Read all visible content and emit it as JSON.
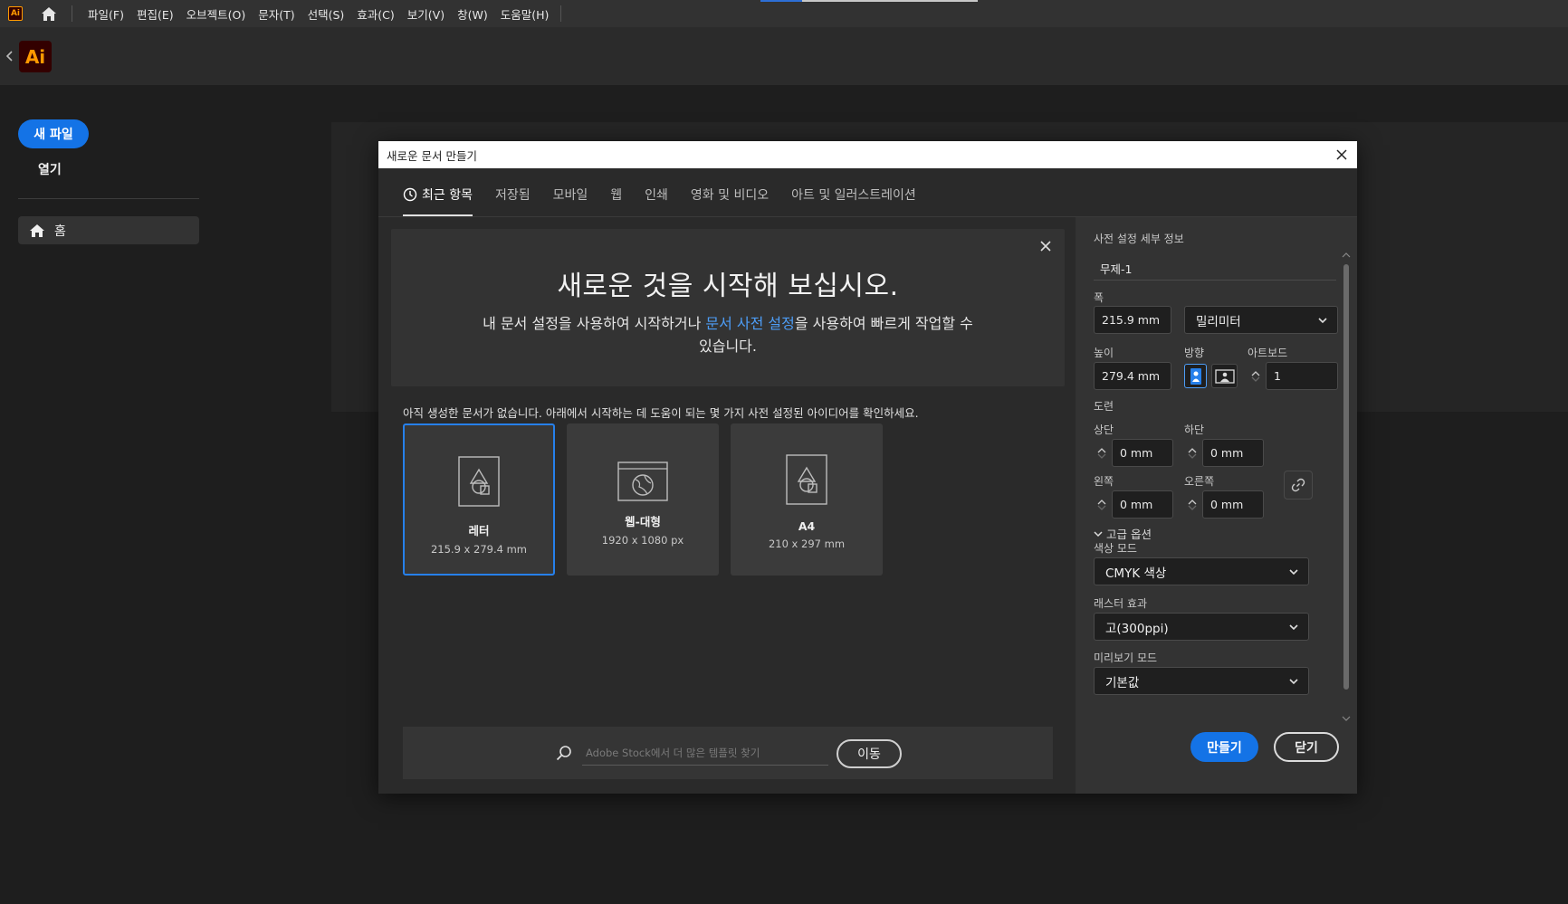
{
  "menubar": {
    "app_mini_logo": "Ai",
    "items": [
      "파일(F)",
      "편집(E)",
      "오브젝트(O)",
      "문자(T)",
      "선택(S)",
      "효과(C)",
      "보기(V)",
      "창(W)",
      "도움말(H)"
    ]
  },
  "appbar": {
    "logo": "Ai"
  },
  "sidebar": {
    "new_file": "새 파일",
    "open": "열기",
    "home": "홈"
  },
  "dialog": {
    "title": "새로운 문서 만들기",
    "tabs": [
      "최근 항목",
      "저장됨",
      "모바일",
      "웹",
      "인쇄",
      "영화 및 비디오",
      "아트 및 일러스트레이션"
    ],
    "hero": {
      "title": "새로운 것을 시작해 보십시오.",
      "desc_before": "내 문서 설정을 사용하여 시작하거나 ",
      "desc_link": "문서 사전 설정",
      "desc_after": "을 사용하여 빠르게 작업할 수 있습니다."
    },
    "info": "아직 생성한 문서가 없습니다. 아래에서 시작하는 데 도움이 되는 몇 가지 사전 설정된 아이디어를 확인하세요.",
    "cards": [
      {
        "name": "레터",
        "size": "215.9 x 279.4 mm"
      },
      {
        "name": "웹-대형",
        "size": "1920 x 1080 px"
      },
      {
        "name": "A4",
        "size": "210 x 297 mm"
      }
    ],
    "stock": {
      "placeholder": "Adobe Stock에서 더 많은 템플릿 찾기",
      "go": "이동"
    },
    "preset": {
      "header": "사전 설정 세부 정보",
      "name": "무제-1",
      "width_label": "폭",
      "width": "215.9 mm",
      "unit": "밀리미터",
      "height_label": "높이",
      "height": "279.4 mm",
      "orientation_label": "방향",
      "artboard_label": "아트보드",
      "artboard": "1",
      "bleed_label": "도련",
      "top_label": "상단",
      "top": "0 mm",
      "bottom_label": "하단",
      "bottom": "0 mm",
      "left_label": "왼쪽",
      "left": "0 mm",
      "right_label": "오른쪽",
      "right": "0 mm",
      "advanced": "고급 옵션",
      "color_mode_label": "색상 모드",
      "color_mode": "CMYK 색상",
      "raster_label": "래스터 효과",
      "raster": "고(300ppi)",
      "preview_label": "미리보기 모드",
      "preview": "기본값",
      "create": "만들기",
      "close": "닫기"
    }
  },
  "colors": {
    "accent": "#1473e6",
    "link": "#4d9df6",
    "logo": "#ff9a00"
  }
}
